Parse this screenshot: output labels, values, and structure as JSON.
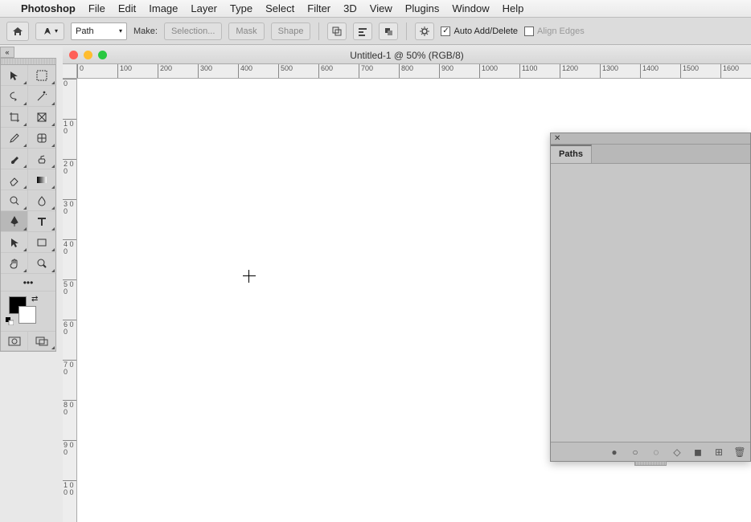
{
  "menubar": {
    "app": "Photoshop",
    "items": [
      "File",
      "Edit",
      "Image",
      "Layer",
      "Type",
      "Select",
      "Filter",
      "3D",
      "View",
      "Plugins",
      "Window",
      "Help"
    ]
  },
  "optionsbar": {
    "mode_selected": "Path",
    "make_label": "Make:",
    "selection_btn": "Selection...",
    "mask_btn": "Mask",
    "shape_btn": "Shape",
    "auto_add_delete": "Auto Add/Delete",
    "align_edges": "Align Edges"
  },
  "document": {
    "title": "Untitled-1 @ 50% (RGB/8)",
    "ruler_h_ticks": [
      "0",
      "100",
      "200",
      "300",
      "400",
      "500",
      "600",
      "700",
      "800",
      "900",
      "1000",
      "1100",
      "1200",
      "1300",
      "1400",
      "1500",
      "1600"
    ],
    "ruler_v_ticks": [
      "0",
      "100",
      "200",
      "300",
      "400",
      "500",
      "600",
      "700",
      "800",
      "900",
      "1000"
    ]
  },
  "toolbox": {
    "tools": [
      {
        "name": "move-tool"
      },
      {
        "name": "rectangular-marquee-tool"
      },
      {
        "name": "lasso-tool"
      },
      {
        "name": "magic-wand-tool"
      },
      {
        "name": "crop-tool"
      },
      {
        "name": "frame-tool"
      },
      {
        "name": "eyedropper-tool"
      },
      {
        "name": "healing-brush-tool"
      },
      {
        "name": "brush-tool"
      },
      {
        "name": "clone-stamp-tool"
      },
      {
        "name": "eraser-tool"
      },
      {
        "name": "gradient-tool"
      },
      {
        "name": "dodge-tool"
      },
      {
        "name": "blur-tool"
      },
      {
        "name": "pen-tool",
        "active": true
      },
      {
        "name": "type-tool"
      },
      {
        "name": "path-selection-tool"
      },
      {
        "name": "rectangle-tool"
      },
      {
        "name": "hand-tool"
      },
      {
        "name": "zoom-tool"
      }
    ]
  },
  "paths_panel": {
    "tab": "Paths"
  }
}
